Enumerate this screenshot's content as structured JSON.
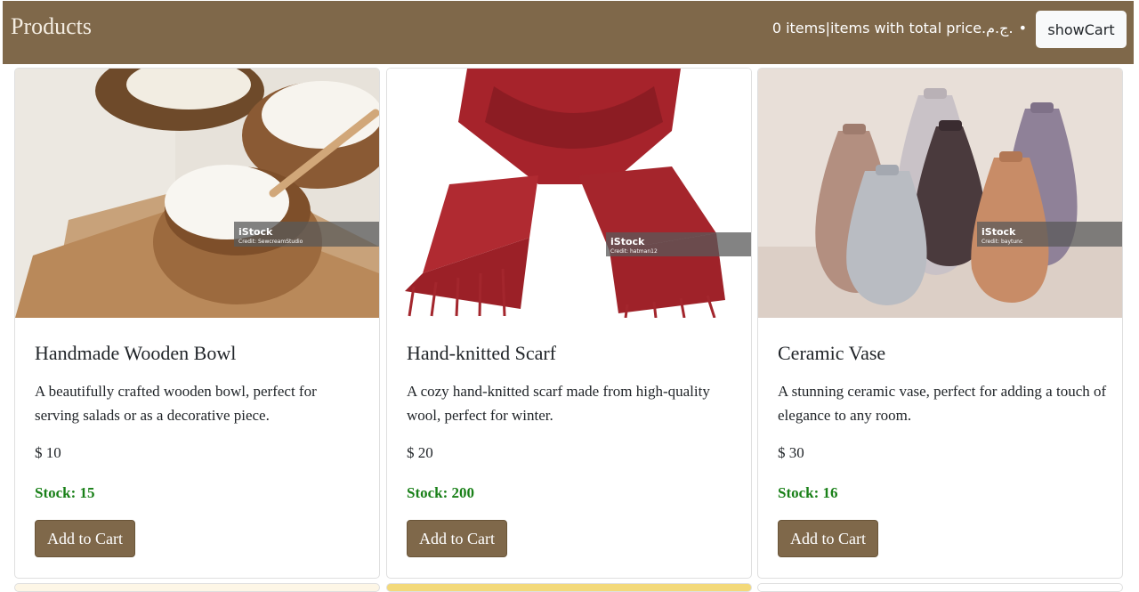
{
  "navbar": {
    "brand": "Products",
    "cart_summary": "0 items|items with total price.ج.م.",
    "bullet": "•",
    "show_cart_label": "showCart"
  },
  "products": [
    {
      "title": "Handmade Wooden Bowl",
      "description": "A beautifully crafted wooden bowl, perfect for serving salads or as a decorative piece.",
      "price": "$ 10",
      "stock": "Stock: 15",
      "button": "Add to Cart",
      "image_icon": "wooden-bowl-image",
      "watermark": "iStock",
      "credit": "Credit: SewcreamStudio"
    },
    {
      "title": "Hand-knitted Scarf",
      "description": "A cozy hand-knitted scarf made from high-quality wool, perfect for winter.",
      "price": "$ 20",
      "stock": "Stock: 200",
      "button": "Add to Cart",
      "image_icon": "red-scarf-image",
      "watermark": "iStock",
      "credit": "Credit: hatman12"
    },
    {
      "title": "Ceramic Vase",
      "description": "A stunning ceramic vase, perfect for adding a touch of elegance to any room.",
      "price": "$ 30",
      "stock": "Stock: 16",
      "button": "Add to Cart",
      "image_icon": "ceramic-vases-image",
      "watermark": "iStock",
      "credit": "Credit: baytunc"
    }
  ],
  "colors": {
    "navbar": "#7f684a",
    "button": "#7f684a",
    "stock": "#198018"
  }
}
